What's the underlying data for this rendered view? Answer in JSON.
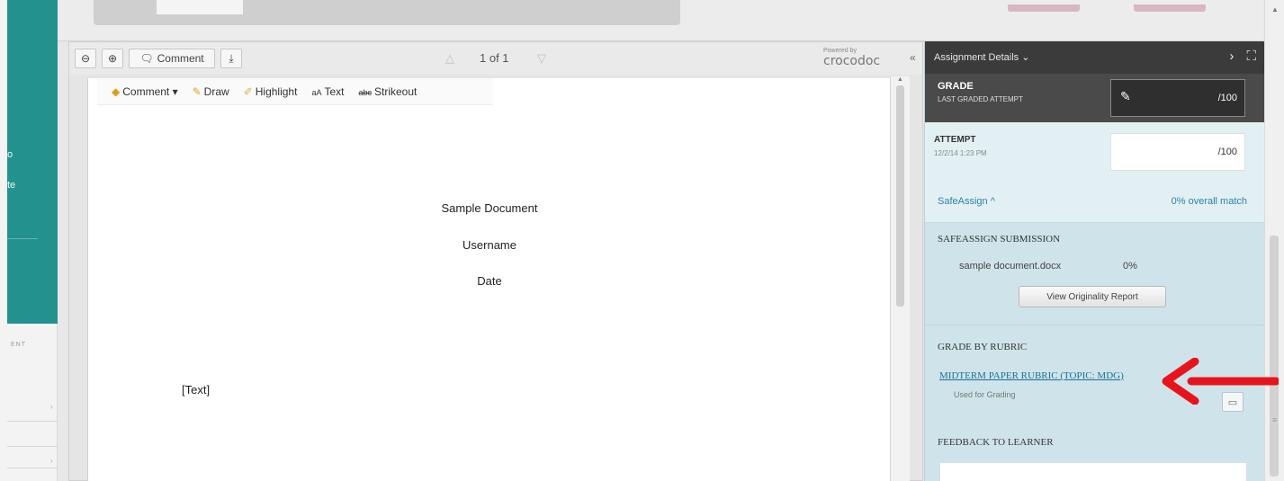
{
  "viewer": {
    "comment_button": "Comment",
    "page_indicator": "1 of 1",
    "powered_by": "Powered by",
    "brand": "crocodoc",
    "annotation_tools": {
      "comment": "Comment",
      "draw": "Draw",
      "highlight": "Highlight",
      "text": "Text",
      "strikeout": "Strikeout"
    }
  },
  "document": {
    "title": "Sample Document",
    "username": "Username",
    "date": "Date",
    "body": "[Text]"
  },
  "sidebar": {
    "teal_line1": "o",
    "teal_line2": "te",
    "section_label": "ENT"
  },
  "panel": {
    "header": "Assignment Details",
    "grade": {
      "label": "GRADE",
      "sublabel": "LAST GRADED ATTEMPT",
      "out_of": "/100"
    },
    "attempt": {
      "label": "ATTEMPT",
      "date": "12/2/14 1:23 PM",
      "out_of": "/100"
    },
    "safeassign": {
      "toggle": "SafeAssign",
      "match": "0% overall match",
      "submission_heading": "SAFEASSIGN SUBMISSION",
      "file": "sample document.docx",
      "percent": "0%",
      "report_button": "View Originality Report"
    },
    "rubric": {
      "heading": "GRADE BY RUBRIC",
      "link": "MIDTERM PAPER RUBRIC (TOPIC: MDG)",
      "used_for": "Used for Grading",
      "feedback_heading": "FEEDBACK TO LEARNER"
    }
  },
  "colors": {
    "teal": "#23928f",
    "panel_dark": "#3b3b3b",
    "panel_light": "#cfe4ea",
    "link": "#1f6e96",
    "annotation_arrow": "#e8141c"
  }
}
